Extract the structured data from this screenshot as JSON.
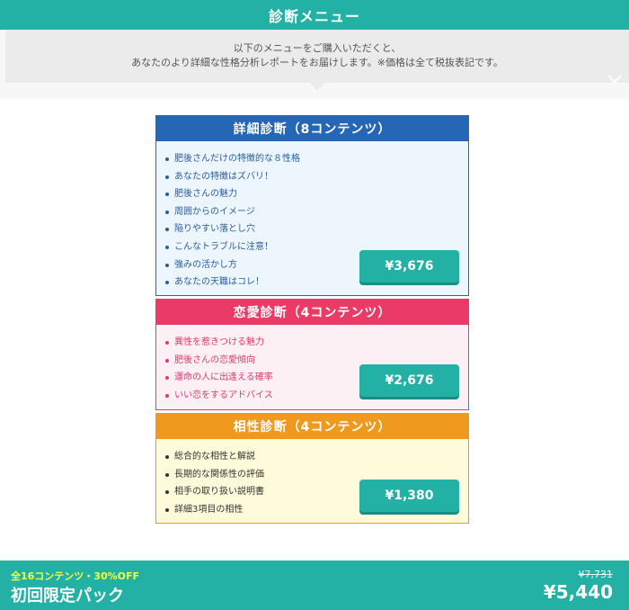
{
  "header": {
    "title": "診断メニュー"
  },
  "notice": {
    "line1": "以下のメニューをご購入いただくと、",
    "line2": "あなたのより詳細な性格分析レポートをお届けします。※価格は全て税抜表記です。"
  },
  "icons": {
    "close": "close-icon"
  },
  "cards": [
    {
      "title": "詳細診断（8コンテンツ）",
      "items": [
        "肥後さんだけの特徴的な８性格",
        "あなたの特徴はズバリ！",
        "肥後さんの魅力",
        "周囲からのイメージ",
        "陥りやすい落とし穴",
        "こんなトラブルに注意！",
        "強みの活かし方",
        "あなたの天職はコレ！"
      ],
      "price": "¥3,676",
      "color": "#2567b5"
    },
    {
      "title": "恋愛診断（4コンテンツ）",
      "items": [
        "異性を惹きつける魅力",
        "肥後さんの恋愛傾向",
        "運命の人に出逢える確率",
        "いい恋をするアドバイス"
      ],
      "price": "¥2,676",
      "color": "#ea3b66"
    },
    {
      "title": "相性診断（4コンテンツ）",
      "items": [
        "総合的な相性と解説",
        "長期的な関係性の評価",
        "相手の取り扱い説明書",
        "詳細3項目の相性"
      ],
      "price": "¥1,380",
      "color": "#ef9a1e"
    }
  ],
  "footer": {
    "promo": "全16コンテンツ・30%OFF",
    "pack_label": "初回限定パック",
    "old_price": "¥7,731",
    "new_price": "¥5,440",
    "accent": "#23b0a5"
  }
}
